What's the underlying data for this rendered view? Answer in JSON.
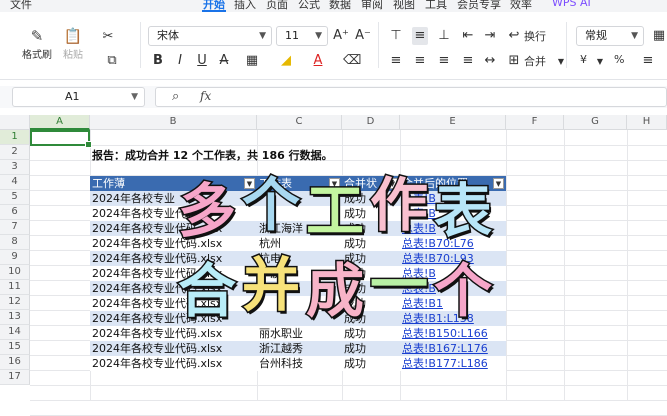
{
  "menubar": {
    "items": [
      "文件",
      "开始",
      "插入",
      "页面",
      "公式",
      "数据",
      "审阅",
      "视图",
      "工具",
      "会员专享",
      "效率",
      "WPS AI"
    ]
  },
  "ribbon": {
    "format_painter": "格式刷",
    "paste": "粘贴",
    "font_name": "宋体",
    "font_size": "11",
    "wrap_text": "换行",
    "merge": "合并",
    "number_format": "常规",
    "currency_symbol": "¥",
    "percent_symbol": "%"
  },
  "formula_bar": {
    "cell_ref": "A1",
    "fx_label": "fx",
    "value": ""
  },
  "columns": [
    "A",
    "B",
    "C",
    "D",
    "E",
    "F",
    "G",
    "H"
  ],
  "rows": [
    "1",
    "2",
    "3",
    "4",
    "5",
    "6",
    "7",
    "8",
    "9",
    "10",
    "11",
    "12",
    "13",
    "14",
    "15",
    "16",
    "17"
  ],
  "report": "报告：成功合并 12 个工作表，共 186 行数据。",
  "table": {
    "headers": [
      "工作薄",
      "工作表",
      "合并状",
      "合并后的位置"
    ],
    "rows": [
      [
        "2024年各校专业",
        "",
        "成功",
        "总表!B"
      ],
      [
        "2024年各校专业代码",
        "",
        "成功",
        "总表!B"
      ],
      [
        "2024年各校专业代码.xlsx",
        "浙江海洋",
        "成功",
        "总表!B"
      ],
      [
        "2024年各校专业代码.xlsx",
        "杭州",
        "成功",
        "总表!B70:L76"
      ],
      [
        "2024年各校专业代码.xlsx",
        "杭电",
        "成功",
        "总表!B70:L93"
      ],
      [
        "2024年各校专业代码.xlsx",
        "宁波",
        "成功",
        "总表!B"
      ],
      [
        "2024年各校专业代码.xlsx",
        "",
        "成功",
        "总表!B"
      ],
      [
        "2024年各校专业代码.xlsx",
        "",
        "成功",
        "总表!B1"
      ],
      [
        "2024年各校专业代码.xlsx",
        "",
        "成功",
        "总表!B1:L138"
      ],
      [
        "2024年各校专业代码.xlsx",
        "丽水职业",
        "成功",
        "总表!B150:L166"
      ],
      [
        "2024年各校专业代码.xlsx",
        "浙江越秀",
        "成功",
        "总表!B167:L176"
      ],
      [
        "2024年各校专业代码.xlsx",
        "台州科技",
        "成功",
        "总表!B177:L186"
      ]
    ]
  },
  "overlay": {
    "line1": [
      "多",
      "个",
      "工",
      "作",
      "表"
    ],
    "line2": [
      "合",
      "并",
      "成",
      "一",
      "个"
    ],
    "colors1": [
      "#f6a6c9",
      "#a8d8f0",
      "#c3f5a0",
      "#f9c0cf",
      "#b8e6f8"
    ],
    "colors2": [
      "#b8ecf7",
      "#f7e27a",
      "#f8b4c8",
      "#b9f0a5",
      "#f6a6c9"
    ]
  }
}
